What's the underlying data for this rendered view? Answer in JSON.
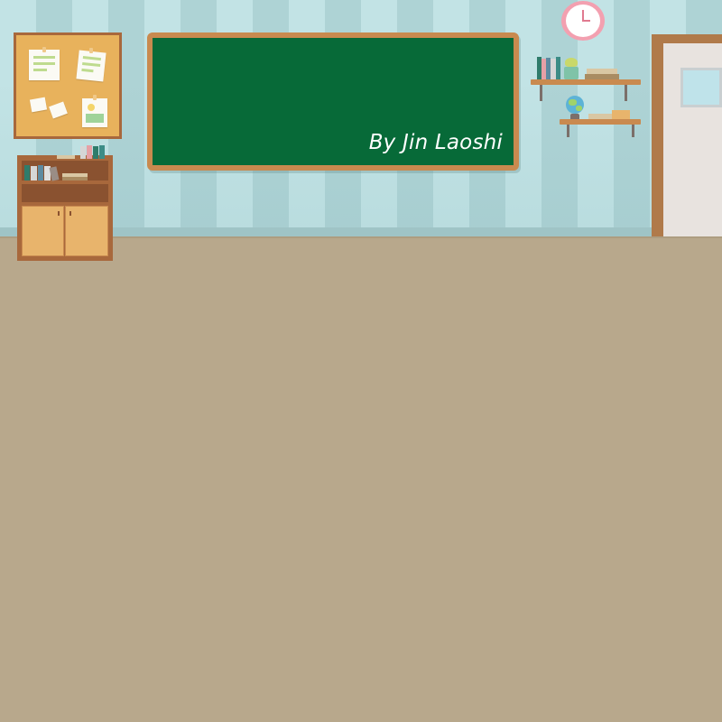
{
  "scene": {
    "type": "classroom-background",
    "blackboard": {
      "text": "By Jin Laoshi",
      "board_color": "#076a38",
      "frame_color": "#c98a4f"
    },
    "colors": {
      "wall_stripe_light": "#c2e3e5",
      "wall_stripe_dark": "#aed3d5",
      "floor": "#b8a88c",
      "wood": "#a8683c"
    },
    "icons": [
      "bulletin-board-icon",
      "blackboard-icon",
      "bookshelf-cabinet-icon",
      "wall-clock-icon",
      "wall-shelf-icon",
      "globe-icon",
      "plant-pot-icon",
      "door-icon"
    ]
  }
}
